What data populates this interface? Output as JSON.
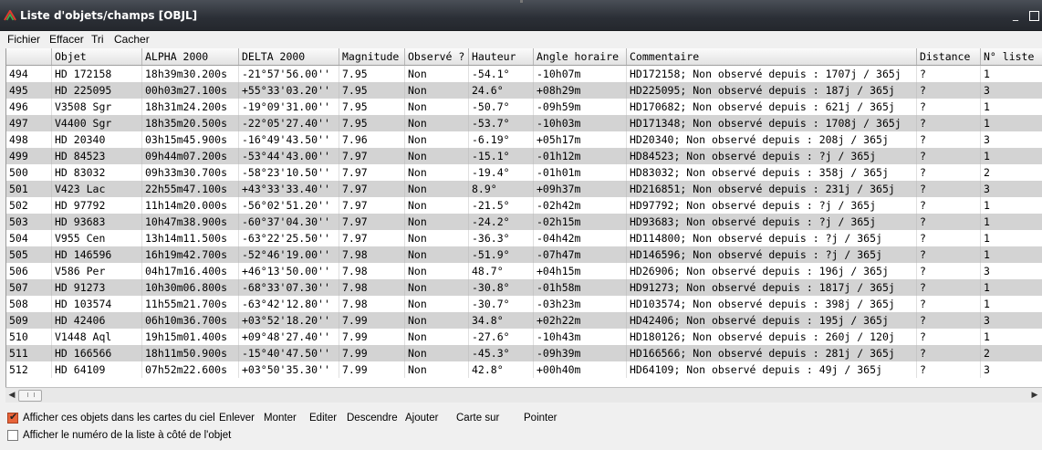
{
  "window": {
    "title": "Liste d'objets/champs [OBJL]",
    "minimize": "_"
  },
  "menu": [
    "Fichier",
    "Effacer",
    "Tri",
    "Cacher"
  ],
  "columns": [
    "",
    "Objet",
    "ALPHA 2000",
    "DELTA 2000",
    "Magnitude",
    "Observé ?",
    "Hauteur",
    "Angle horaire",
    "Commentaire",
    "Distance",
    "N° liste"
  ],
  "rows": [
    [
      "494",
      "HD 172158",
      "18h39m30.200s",
      "-21°57'56.00''",
      "7.95",
      "Non",
      "-54.1°",
      "-10h07m",
      "HD172158; Non observé depuis : 1707j / 365j",
      "?",
      "1"
    ],
    [
      "495",
      "HD 225095",
      "00h03m27.100s",
      "+55°33'03.20''",
      "7.95",
      "Non",
      "24.6°",
      "+08h29m",
      "HD225095; Non observé depuis : 187j / 365j",
      "?",
      "3"
    ],
    [
      "496",
      "V3508 Sgr",
      "18h31m24.200s",
      "-19°09'31.00''",
      "7.95",
      "Non",
      "-50.7°",
      "-09h59m",
      "HD170682; Non observé depuis : 621j / 365j",
      "?",
      "1"
    ],
    [
      "497",
      "V4400 Sgr",
      "18h35m20.500s",
      "-22°05'27.40''",
      "7.95",
      "Non",
      "-53.7°",
      "-10h03m",
      "HD171348; Non observé depuis : 1708j / 365j",
      "?",
      "1"
    ],
    [
      "498",
      "HD 20340",
      "03h15m45.900s",
      "-16°49'43.50''",
      "7.96",
      "Non",
      "-6.19°",
      "+05h17m",
      "HD20340; Non observé depuis : 208j / 365j",
      "?",
      "3"
    ],
    [
      "499",
      "HD 84523",
      "09h44m07.200s",
      "-53°44'43.00''",
      "7.97",
      "Non",
      "-15.1°",
      "-01h12m",
      "HD84523; Non observé depuis : ?j / 365j",
      "?",
      "1"
    ],
    [
      "500",
      "HD 83032",
      "09h33m30.700s",
      "-58°23'10.50''",
      "7.97",
      "Non",
      "-19.4°",
      "-01h01m",
      "HD83032; Non observé depuis : 358j / 365j",
      "?",
      "2"
    ],
    [
      "501",
      "V423 Lac",
      "22h55m47.100s",
      "+43°33'33.40''",
      "7.97",
      "Non",
      "8.9°",
      "+09h37m",
      "HD216851; Non observé depuis : 231j / 365j",
      "?",
      "3"
    ],
    [
      "502",
      "HD 97792",
      "11h14m20.000s",
      "-56°02'51.20''",
      "7.97",
      "Non",
      "-21.5°",
      "-02h42m",
      "HD97792; Non observé depuis : ?j / 365j",
      "?",
      "1"
    ],
    [
      "503",
      "HD 93683",
      "10h47m38.900s",
      "-60°37'04.30''",
      "7.97",
      "Non",
      "-24.2°",
      "-02h15m",
      "HD93683; Non observé depuis : ?j / 365j",
      "?",
      "1"
    ],
    [
      "504",
      "V955 Cen",
      "13h14m11.500s",
      "-63°22'25.50''",
      "7.97",
      "Non",
      "-36.3°",
      "-04h42m",
      "HD114800; Non observé depuis : ?j / 365j",
      "?",
      "1"
    ],
    [
      "505",
      "HD 146596",
      "16h19m42.700s",
      "-52°46'19.00''",
      "7.98",
      "Non",
      "-51.9°",
      "-07h47m",
      "HD146596; Non observé depuis : ?j / 365j",
      "?",
      "1"
    ],
    [
      "506",
      "V586 Per",
      "04h17m16.400s",
      "+46°13'50.00''",
      "7.98",
      "Non",
      "48.7°",
      "+04h15m",
      "HD26906; Non observé depuis : 196j / 365j",
      "?",
      "3"
    ],
    [
      "507",
      "HD 91273",
      "10h30m06.800s",
      "-68°33'07.30''",
      "7.98",
      "Non",
      "-30.8°",
      "-01h58m",
      "HD91273; Non observé depuis : 1817j / 365j",
      "?",
      "1"
    ],
    [
      "508",
      "HD 103574",
      "11h55m21.700s",
      "-63°42'12.80''",
      "7.98",
      "Non",
      "-30.7°",
      "-03h23m",
      "HD103574; Non observé depuis : 398j / 365j",
      "?",
      "1"
    ],
    [
      "509",
      "HD 42406",
      "06h10m36.700s",
      "+03°52'18.20''",
      "7.99",
      "Non",
      "34.8°",
      "+02h22m",
      "HD42406; Non observé depuis : 195j / 365j",
      "?",
      "3"
    ],
    [
      "510",
      "V1448 Aql",
      "19h15m01.400s",
      "+09°48'27.40''",
      "7.99",
      "Non",
      "-27.6°",
      "-10h43m",
      "HD180126; Non observé depuis : 260j / 120j",
      "?",
      "1"
    ],
    [
      "511",
      "HD 166566",
      "18h11m50.900s",
      "-15°40'47.50''",
      "7.99",
      "Non",
      "-45.3°",
      "-09h39m",
      "HD166566; Non observé depuis : 281j / 365j",
      "?",
      "2"
    ],
    [
      "512",
      "HD 64109",
      "07h52m22.600s",
      "+03°50'35.30''",
      "7.99",
      "Non",
      "42.8°",
      "+00h40m",
      "HD64109; Non observé depuis : 49j / 365j",
      "?",
      "3"
    ]
  ],
  "options": {
    "show_in_maps": {
      "label": "Afficher ces objets dans les cartes du ciel",
      "checked": true
    },
    "show_list_number": {
      "label": "Afficher le numéro de la liste à côté de l'objet",
      "checked": false
    }
  },
  "buttons": [
    "Enlever",
    "Monter",
    "Editer",
    "Descendre",
    "Ajouter",
    "Carte sur",
    "Pointer"
  ]
}
